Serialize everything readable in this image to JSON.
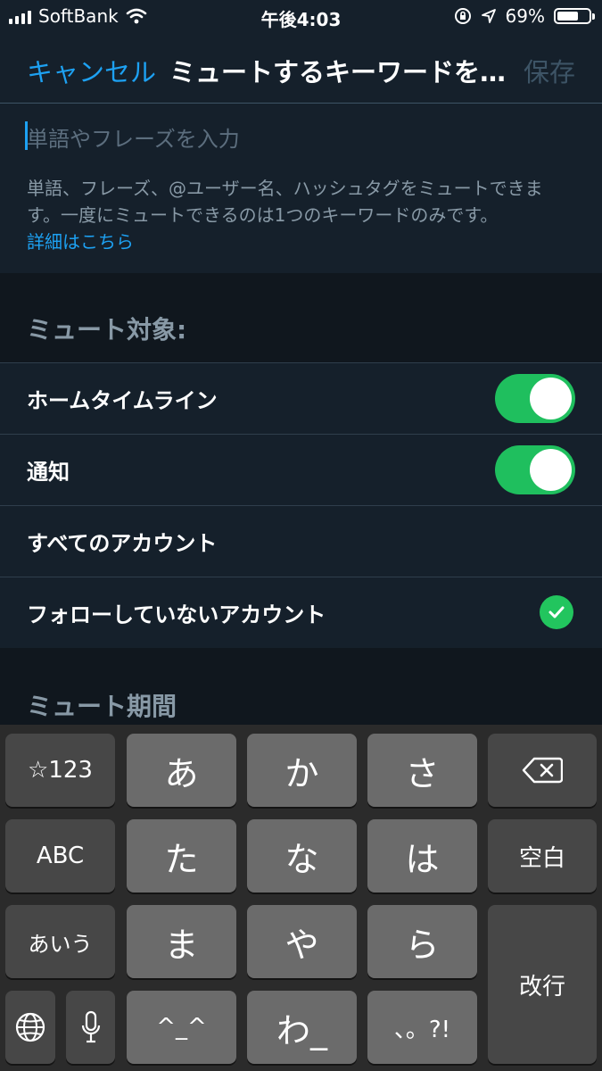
{
  "status": {
    "carrier": "SoftBank",
    "time": "午後4:03",
    "battery_pct": "69%",
    "battery_level": 0.69
  },
  "nav": {
    "cancel": "キャンセル",
    "title": "ミュートするキーワードを…",
    "save": "保存"
  },
  "input": {
    "placeholder": "単語やフレーズを入力",
    "value": ""
  },
  "help": {
    "text": "単語、フレーズ、@ユーザー名、ハッシュタグをミュートできます。一度にミュートできるのは1つのキーワードのみです。",
    "link": "詳細はこちら"
  },
  "mute_target": {
    "heading": "ミュート対象:",
    "items": [
      {
        "label": "ホームタイムライン",
        "toggle": true
      },
      {
        "label": "通知",
        "toggle": true
      },
      {
        "label": "すべてのアカウント",
        "selected": false
      },
      {
        "label": "フォローしていないアカウント",
        "selected": true
      }
    ]
  },
  "mute_duration": {
    "heading": "ミュート期間"
  },
  "keyboard": {
    "row1": [
      "☆123",
      "あ",
      "か",
      "さ"
    ],
    "row2": [
      "ABC",
      "た",
      "な",
      "は",
      "空白"
    ],
    "row3": [
      "あいう",
      "ま",
      "や",
      "ら",
      "改行"
    ],
    "row4": [
      "^_^",
      "わ_",
      "、。?!"
    ],
    "icons": {
      "delete": "delete-icon",
      "globe": "globe-icon",
      "mic": "microphone-icon"
    }
  },
  "colors": {
    "accent": "#1da1f2",
    "background": "#15202b",
    "toggle_on": "#1fbf5e"
  }
}
